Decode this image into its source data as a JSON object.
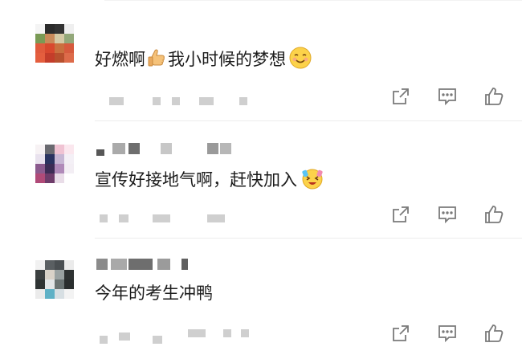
{
  "comments": [
    {
      "text": "好燃啊",
      "text_after": "我小时候的梦想",
      "emoji_inline": "thumbs-up-emoji",
      "emoji_end": "smiling-face-emoji"
    },
    {
      "text": "宣传好接地气啊，赶快加入",
      "emoji_end": "excited-face-emoji"
    },
    {
      "text": "今年的考生冲鸭"
    }
  ],
  "icons": {
    "share": "share-icon",
    "reply": "comment-icon",
    "like": "thumbs-up-icon"
  },
  "colors": {
    "text": "#1c1c1c",
    "icon": "#7a7a7a",
    "blur": "#cfcfcf",
    "divider": "#ececec"
  }
}
